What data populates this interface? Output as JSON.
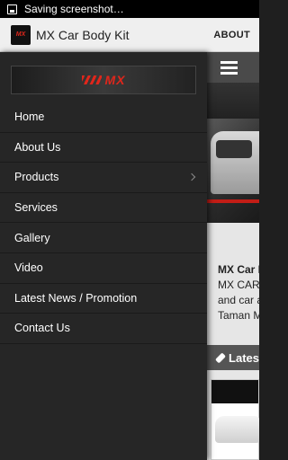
{
  "status_bar": {
    "notification": "Saving screenshot…"
  },
  "app_bar": {
    "title": "MX Car Body Kit",
    "about_label": "ABOUT",
    "logo_text": "MX"
  },
  "drawer": {
    "banner_text": "MX",
    "items": [
      {
        "label": "Home",
        "has_submenu": false
      },
      {
        "label": "About Us",
        "has_submenu": false
      },
      {
        "label": "Products",
        "has_submenu": true
      },
      {
        "label": "Services",
        "has_submenu": false
      },
      {
        "label": "Gallery",
        "has_submenu": false
      },
      {
        "label": "Video",
        "has_submenu": false
      },
      {
        "label": "Latest News / Promotion",
        "has_submenu": false
      },
      {
        "label": "Contact Us",
        "has_submenu": false
      }
    ]
  },
  "content": {
    "heading_partial": "MX Car B",
    "line1": "MX CAR",
    "line2": "and car a",
    "line3": "Taman M",
    "news_label": "Lates"
  },
  "colors": {
    "accent_red": "#e0261b",
    "drawer_bg": "#262626",
    "app_bar_bg": "#efefef"
  }
}
